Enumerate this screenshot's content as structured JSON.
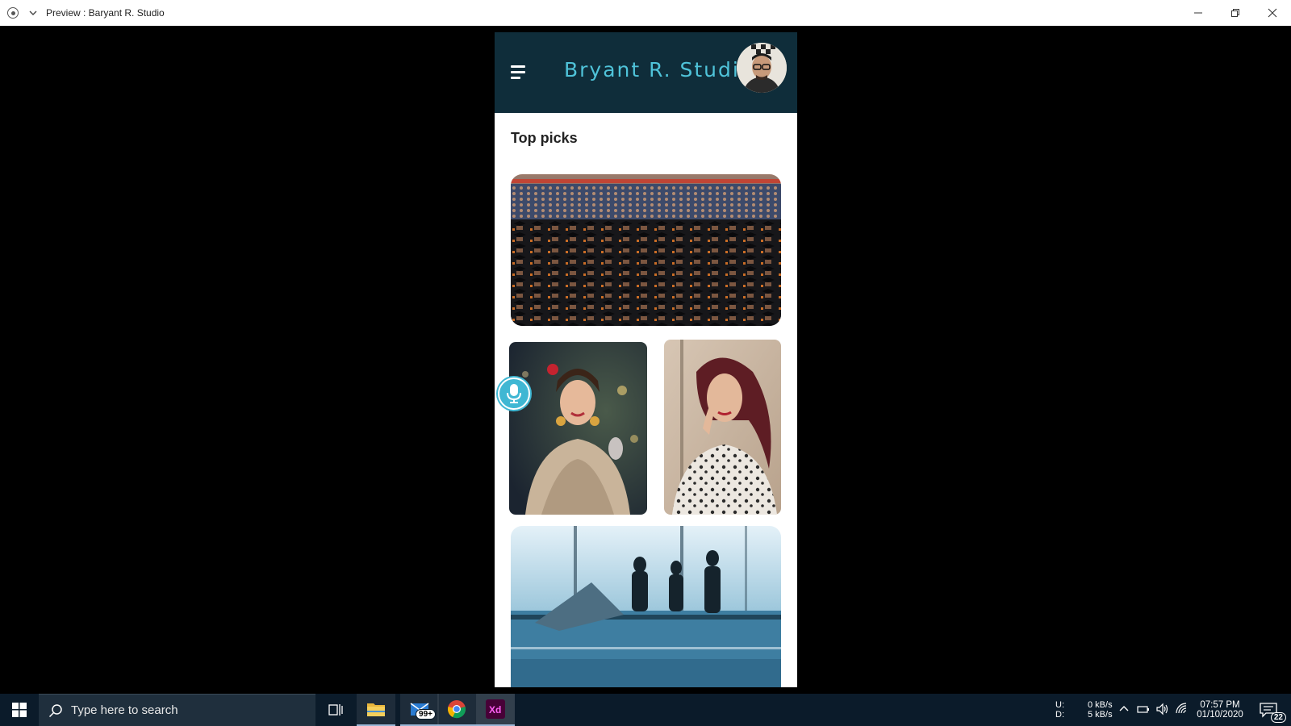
{
  "window": {
    "title": "Preview : Baryant R. Studio"
  },
  "app": {
    "title": "Bryant R. Studio",
    "section_title": "Top picks",
    "images": [
      {
        "name": "graduation-crowd-image"
      },
      {
        "name": "bride-portrait-image"
      },
      {
        "name": "red-hair-portrait-image"
      },
      {
        "name": "office-meeting-image"
      }
    ],
    "colors": {
      "header_bg": "#0f2d3a",
      "accent": "#4fc3d9"
    }
  },
  "taskbar": {
    "search_placeholder": "Type here to search",
    "mail_badge": "99+",
    "net_labels": {
      "upload": "U:",
      "download": "D:"
    },
    "net_values": {
      "upload": "0 kB/s",
      "download": "5 kB/s"
    },
    "time": "07:57 PM",
    "date": "01/10/2020",
    "notification_count": "22"
  }
}
